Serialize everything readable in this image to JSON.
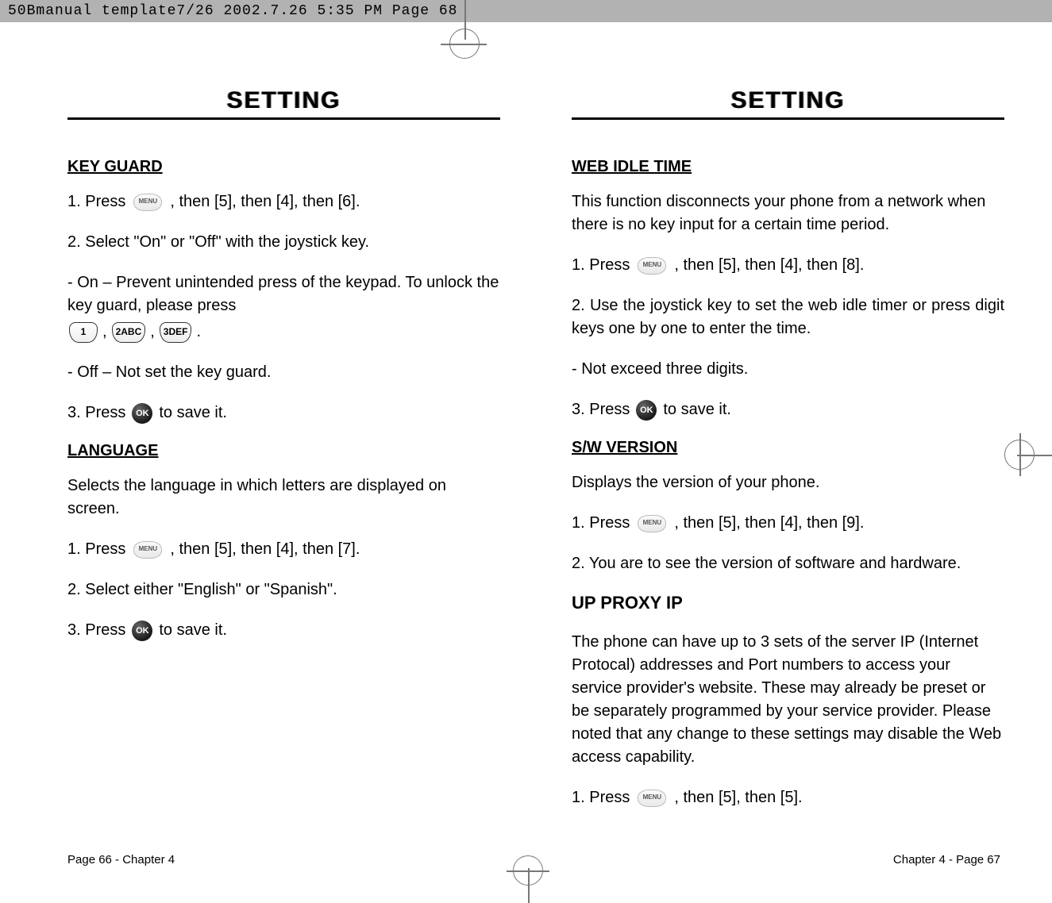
{
  "header_strip": "50Bmanual template7/26  2002.7.26  5:35 PM  Page 68",
  "left": {
    "title": "SETTING",
    "key_guard": {
      "heading": "KEY GUARD",
      "step1a": "1. Press",
      "step1b": ", then [5], then [4], then [6].",
      "step2": "2. Select \"On\" or \"Off\" with the joystick key.",
      "note_on_a": "- On – Prevent unintended press of the keypad. To unlock the key guard, please press",
      "key1": "1",
      "key2": "2ABC",
      "key3": "3DEF",
      "note_off": "- Off – Not set the key guard.",
      "step3a": "3. Press",
      "step3b": "to save it."
    },
    "language": {
      "heading": "LANGUAGE",
      "intro": "Selects the language in which letters are displayed on screen.",
      "step1a": "1. Press",
      "step1b": ", then [5], then [4], then [7].",
      "step2": "2. Select either \"English\" or \"Spanish\".",
      "step3a": "3. Press",
      "step3b": "to save it."
    },
    "footer": "Page 66 - Chapter 4"
  },
  "right": {
    "title": "SETTING",
    "web_idle": {
      "heading": "WEB IDLE TIME",
      "intro": "This function disconnects your phone from a network when there is no key input for a certain time period.",
      "step1a": "1. Press",
      "step1b": ", then [5], then [4], then [8].",
      "step2": "2. Use the joystick key to set the web idle timer or press digit keys one by one to enter the time.",
      "note": "- Not exceed three digits.",
      "step3a": "3. Press",
      "step3b": "to save it."
    },
    "sw_version": {
      "heading": "S/W VERSION",
      "intro": "Displays the version of your phone.",
      "step1a": "1. Press",
      "step1b": ", then [5], then [4], then [9].",
      "step2": "2. You are to see the version of software and hardware."
    },
    "up_proxy": {
      "heading": "UP PROXY IP",
      "intro": "The phone can have up to 3 sets of the server IP (Internet Protocal) addresses and Port numbers to access your service provider's website. These may already be preset or be separately programmed by your service provider. Please noted that any change to these settings may disable the Web access capability.",
      "step1a": "1. Press",
      "step1b": ", then [5], then [5]."
    },
    "footer": "Chapter 4 - Page 67"
  },
  "icon_labels": {
    "menu": "MENU",
    "ok": "OK"
  }
}
